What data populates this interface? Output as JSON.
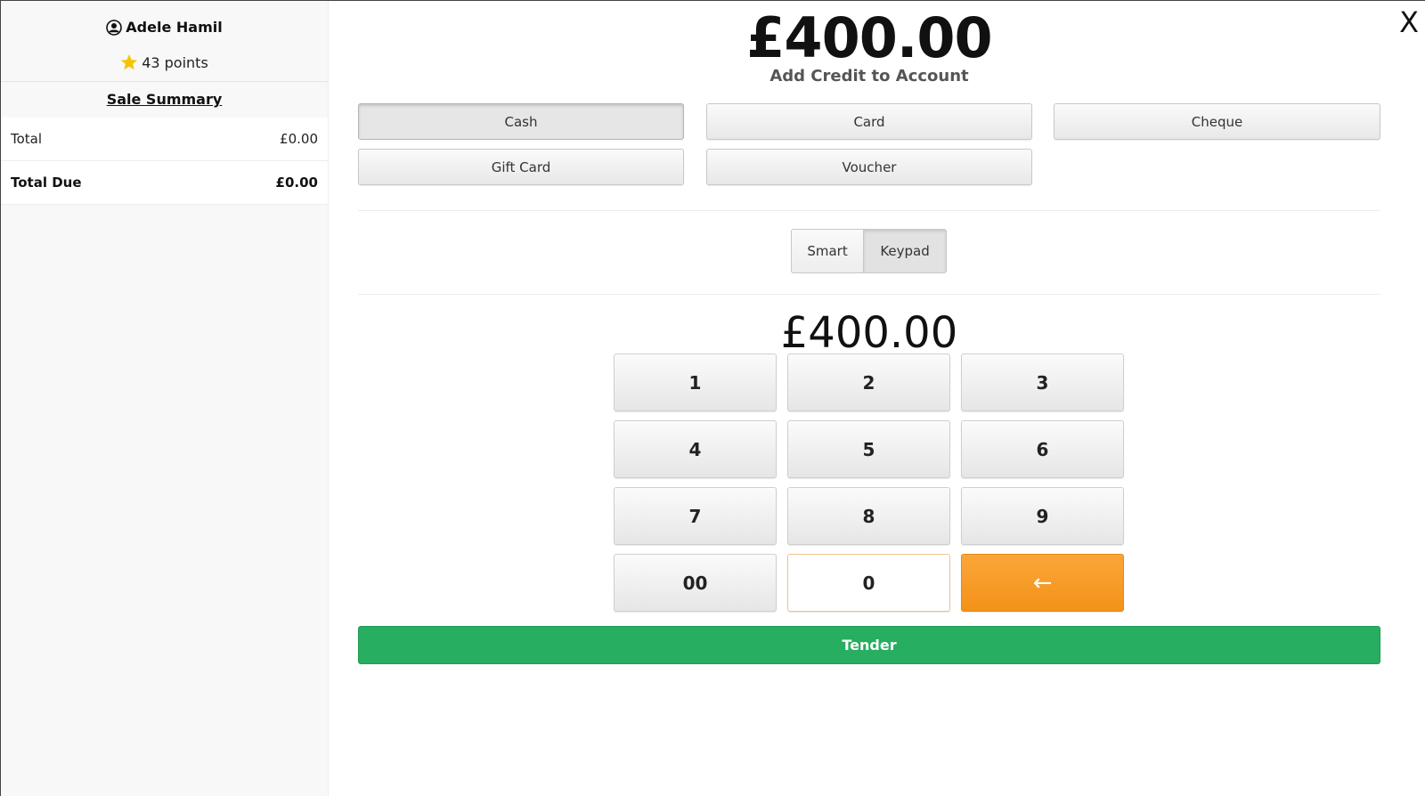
{
  "customer": {
    "name": "Adele Hamil",
    "points": "43 points"
  },
  "summary": {
    "title": "Sale Summary",
    "rows": [
      {
        "label": "Total",
        "value": "£0.00"
      },
      {
        "label": "Total Due",
        "value": "£0.00"
      }
    ]
  },
  "header": {
    "amount": "£400.00",
    "subtitle": "Add Credit to Account",
    "close_label": "X"
  },
  "payment_methods": [
    "Cash",
    "Card",
    "Cheque",
    "Gift Card",
    "Voucher"
  ],
  "payment_selected": "Cash",
  "entry_mode": {
    "options": [
      "Smart",
      "Keypad"
    ],
    "selected": "Keypad"
  },
  "entry_display": "£400.00",
  "keypad": {
    "keys": [
      "1",
      "2",
      "3",
      "4",
      "5",
      "6",
      "7",
      "8",
      "9",
      "00",
      "0",
      "←"
    ]
  },
  "tender_label": "Tender",
  "colors": {
    "tender_green": "#27ae60",
    "backspace_orange": "#f7981f",
    "star_yellow": "#f5c400"
  }
}
